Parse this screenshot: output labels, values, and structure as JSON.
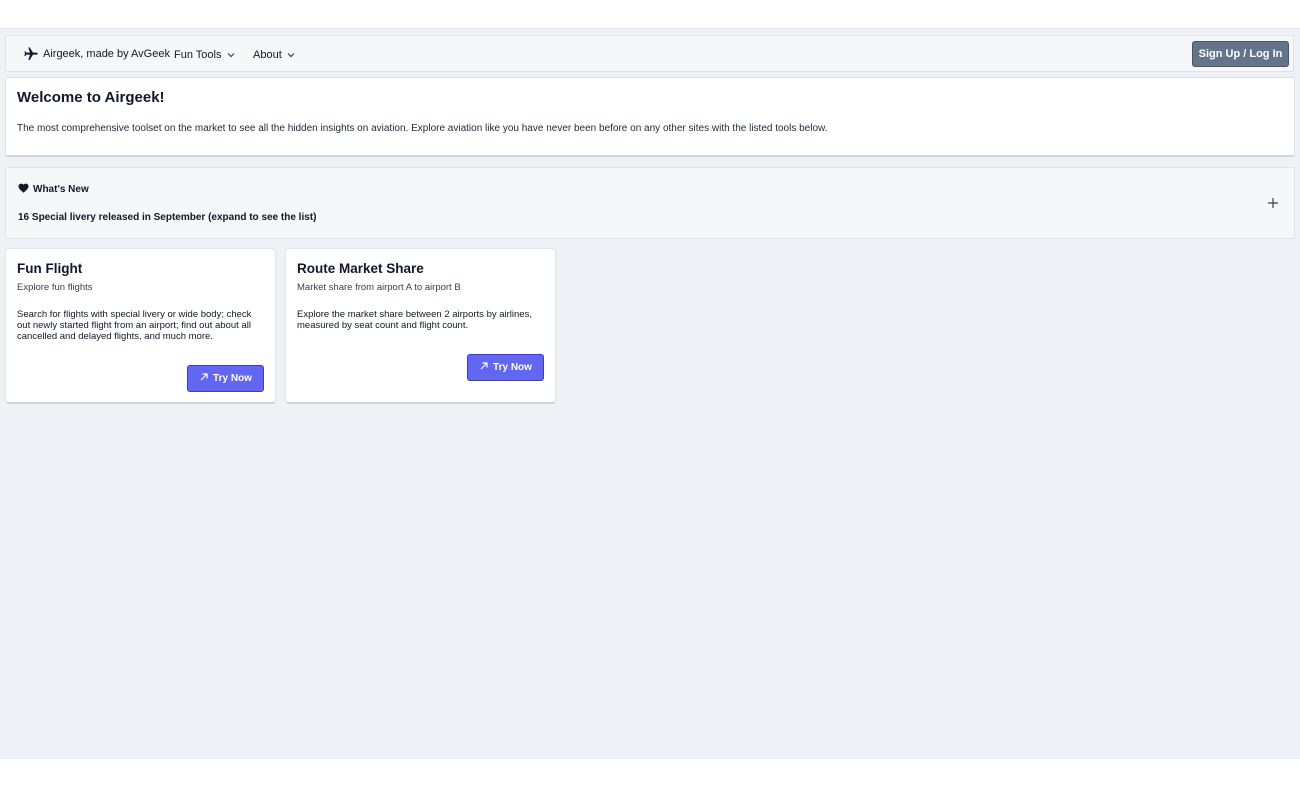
{
  "navbar": {
    "brand": "Airgeek, made by AvGeek",
    "fun_tools": "Fun Tools",
    "about": "About",
    "signup": "Sign Up / Log In"
  },
  "welcome": {
    "title": "Welcome to Airgeek!",
    "description": "The most comprehensive toolset on the market to see all the hidden insights on aviation. Explore aviation like you have never been before on any other sites with the listed tools below."
  },
  "whats_new": {
    "title": "What's New",
    "summary": "16 Special livery released in September (expand to see the list)"
  },
  "cards": [
    {
      "title": "Fun Flight",
      "subtitle": "Explore fun flights",
      "body": "Search for flights with special livery or wide body; check out newly started flight from an airport; find out about all cancelled and delayed flights, and much more.",
      "button": "Try Now"
    },
    {
      "title": "Route Market Share",
      "subtitle": "Market share from airport A to airport B",
      "body": "Explore the market share between 2 airports by airlines, measured by seat count and flight count.",
      "button": "Try Now"
    }
  ],
  "icons": {
    "brand": "airplane-icon",
    "menu": "chevron-down-icon",
    "whats_new": "heart-icon",
    "expand": "plus-icon",
    "try": "arrow-up-right-icon"
  },
  "colors": {
    "primary_button": "#6366f1",
    "signup_button": "#64748b",
    "page_bg": "#eef1f6"
  }
}
